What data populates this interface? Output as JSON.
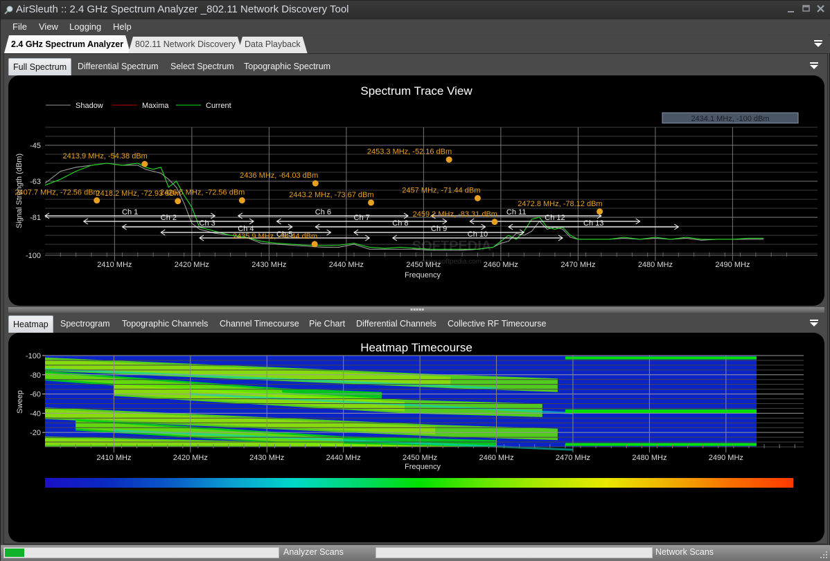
{
  "window": {
    "title": "AirSleuth :: 2.4 GHz Spectrum Analyzer _802.11 Network Discovery Tool",
    "controls": [
      "minimize",
      "maximize",
      "close"
    ]
  },
  "menu": [
    "File",
    "View",
    "Logging",
    "Help"
  ],
  "main_tabs": [
    {
      "label": "2.4 GHz Spectrum Analyzer",
      "active": true
    },
    {
      "label": "802.11 Network Discovery",
      "active": false
    },
    {
      "label": "Data Playback",
      "active": false
    }
  ],
  "spectrum_tabs": [
    {
      "label": "Full Spectrum",
      "active": true
    },
    {
      "label": "Differential Spectrum",
      "active": false
    },
    {
      "label": "Select Spectrum",
      "active": false
    },
    {
      "label": "Topographic Spectrum",
      "active": false
    }
  ],
  "analysis_tabs": [
    {
      "label": "Heatmap",
      "active": true
    },
    {
      "label": "Spectrogram",
      "active": false
    },
    {
      "label": "Topographic Channels",
      "active": false
    },
    {
      "label": "Channel Timecourse",
      "active": false
    },
    {
      "label": "Pie Chart",
      "active": false
    },
    {
      "label": "Differential Channels",
      "active": false
    },
    {
      "label": "Collective RF Timecourse",
      "active": false
    }
  ],
  "status": {
    "analyzer_label": "Analyzer Scans",
    "analyzer_progress": 0.07,
    "network_label": "Network Scans",
    "network_progress": 0.0
  },
  "watermark": "www.softpedia.com",
  "chart_data": [
    {
      "type": "line",
      "title": "Spectrum Trace View",
      "xlabel": "Frequency",
      "ylabel": "Signal Strength (dBm)",
      "xlim": [
        2401,
        2498
      ],
      "ylim": [
        -100,
        -36
      ],
      "x_ticks": [
        2410,
        2420,
        2430,
        2440,
        2450,
        2460,
        2470,
        2480,
        2490
      ],
      "x_tick_labels": [
        "2410 MHz",
        "2420 MHz",
        "2430 MHz",
        "2440 MHz",
        "2450 MHz",
        "2460 MHz",
        "2470 MHz",
        "2480 MHz",
        "2490 MHz"
      ],
      "y_ticks": [
        -45,
        -63,
        -81,
        -100
      ],
      "y_tick_labels": [
        "-45",
        "-63",
        "-81",
        "-100"
      ],
      "grid": true,
      "legend": {
        "position": "top-left",
        "entries": [
          {
            "name": "Shadow",
            "color": "#9a9a9a"
          },
          {
            "name": "Maxima",
            "color": "#c00000"
          },
          {
            "name": "Current",
            "color": "#22dd22"
          }
        ]
      },
      "cursor_readout": "2434.1 MHz,   -100 dBm",
      "series": [
        {
          "name": "Current",
          "color": "#22dd22",
          "x": [
            2401,
            2403,
            2405,
            2407,
            2409,
            2411,
            2413,
            2414,
            2415,
            2416,
            2417,
            2418,
            2419,
            2420,
            2421,
            2422,
            2423,
            2425,
            2427,
            2429,
            2431,
            2433,
            2435,
            2437,
            2439,
            2441,
            2443,
            2445,
            2447,
            2449,
            2451,
            2453,
            2455,
            2457,
            2459,
            2460,
            2461,
            2462,
            2463,
            2464,
            2465,
            2466,
            2467,
            2468,
            2469,
            2470,
            2472,
            2474,
            2476,
            2478,
            2480,
            2482,
            2484,
            2486,
            2488,
            2490,
            2492,
            2494
          ],
          "y": [
            -65,
            -62,
            -58,
            -55,
            -54,
            -55,
            -54,
            -56,
            -57,
            -56,
            -66,
            -63,
            -70,
            -76,
            -86,
            -87,
            -88,
            -90,
            -91,
            -93,
            -94,
            -94.5,
            -95,
            -95.2,
            -95,
            -94,
            -96,
            -96.5,
            -96,
            -96.5,
            -97,
            -97,
            -97,
            -97,
            -96,
            -93,
            -90,
            -92,
            -88,
            -82,
            -81,
            -86,
            -87,
            -86,
            -90,
            -92,
            -92,
            -92,
            -91,
            -92,
            -91,
            -92,
            -91,
            -92,
            -92,
            -92,
            -91.5,
            -91.5
          ]
        },
        {
          "name": "Shadow",
          "color": "#9a9a9a",
          "x": [
            2401,
            2403,
            2405,
            2407,
            2409,
            2411,
            2413,
            2414,
            2415,
            2416,
            2417,
            2418,
            2419,
            2420,
            2421,
            2422,
            2423,
            2425,
            2427,
            2429,
            2431,
            2433,
            2435,
            2437,
            2439,
            2441,
            2443,
            2445,
            2447,
            2449,
            2451,
            2453,
            2455,
            2457,
            2459,
            2460,
            2461,
            2462,
            2463,
            2464,
            2465,
            2466,
            2467,
            2468,
            2469,
            2470,
            2472,
            2474,
            2476,
            2478,
            2480,
            2482,
            2484,
            2486,
            2488,
            2490,
            2492,
            2494
          ],
          "y": [
            -64,
            -58,
            -56,
            -55,
            -54,
            -55,
            -55,
            -57,
            -58,
            -59,
            -62,
            -66,
            -74,
            -84,
            -87,
            -88,
            -89,
            -90,
            -91,
            -94,
            -94.5,
            -95,
            -95.5,
            -96,
            -96,
            -94.5,
            -97,
            -97,
            -97,
            -97,
            -97.5,
            -97.5,
            -97.5,
            -97,
            -96,
            -94,
            -93,
            -89,
            -90,
            -88,
            -83,
            -87,
            -86,
            -87,
            -91,
            -92,
            -92,
            -92,
            -91.5,
            -92,
            -91.5,
            -92,
            -91.5,
            -92.5,
            -92,
            -92,
            -92,
            -92
          ]
        }
      ],
      "peaks": [
        {
          "freq": 2407.7,
          "dbm": -72.56,
          "label": "2407.7 MHz,   -72.56 dBm"
        },
        {
          "freq": 2413.9,
          "dbm": -54.38,
          "label": "2413.9 MHz,   -54.38 dBm"
        },
        {
          "freq": 2418.2,
          "dbm": -72.93,
          "label": "2418.2 MHz,   -72.93 dBm"
        },
        {
          "freq": 2426.5,
          "dbm": -72.56,
          "label": "2426.5 MHz,   -72.56 dBm"
        },
        {
          "freq": 2435.9,
          "dbm": -94.44,
          "label": "2435.9 MHz,   -94.44 dBm"
        },
        {
          "freq": 2436,
          "dbm": -64.03,
          "label": "2436 MHz,   -64.03 dBm"
        },
        {
          "freq": 2443.2,
          "dbm": -73.67,
          "label": "2443.2 MHz,   -73.67 dBm"
        },
        {
          "freq": 2453.3,
          "dbm": -52.16,
          "label": "2453.3 MHz,   -52.16 dBm"
        },
        {
          "freq": 2457,
          "dbm": -71.44,
          "label": "2457 MHz,   -71.44 dBm"
        },
        {
          "freq": 2459.2,
          "dbm": -83.31,
          "label": "2459.2 MHz,   -83.31 dBm"
        },
        {
          "freq": 2472.8,
          "dbm": -78.12,
          "label": "2472.8 MHz,   -78.12 dBm"
        }
      ],
      "channels": [
        {
          "name": "Ch 1",
          "low": 2401,
          "high": 2423
        },
        {
          "name": "Ch 2",
          "low": 2406,
          "high": 2428
        },
        {
          "name": "Ch 3",
          "low": 2411,
          "high": 2433
        },
        {
          "name": "Ch 4",
          "low": 2416,
          "high": 2438
        },
        {
          "name": "Ch 5",
          "low": 2421,
          "high": 2443
        },
        {
          "name": "Ch 6",
          "low": 2426,
          "high": 2448
        },
        {
          "name": "Ch 7",
          "low": 2431,
          "high": 2453
        },
        {
          "name": "Ch 8",
          "low": 2436,
          "high": 2458
        },
        {
          "name": "Ch 9",
          "low": 2441,
          "high": 2463
        },
        {
          "name": "Ch 10",
          "low": 2446,
          "high": 2468
        },
        {
          "name": "Ch 11",
          "low": 2451,
          "high": 2473
        },
        {
          "name": "Ch 12",
          "low": 2456,
          "high": 2478
        },
        {
          "name": "Ch 13",
          "low": 2461,
          "high": 2483
        }
      ]
    },
    {
      "type": "heatmap",
      "title": "Heatmap Timecourse",
      "xlabel": "Frequency",
      "ylabel": "Sweep",
      "xlim": [
        2401,
        2498
      ],
      "ylim": [
        -100,
        -5
      ],
      "x_ticks": [
        2410,
        2420,
        2430,
        2440,
        2450,
        2460,
        2470,
        2480,
        2490
      ],
      "x_tick_labels": [
        "2410 MHz",
        "2420 MHz",
        "2430 MHz",
        "2440 MHz",
        "2450 MHz",
        "2460 MHz",
        "2470 MHz",
        "2480 MHz",
        "2490 MHz"
      ],
      "y_ticks": [
        -100,
        -80,
        -60,
        -40,
        -20
      ],
      "y_tick_labels": [
        "-100",
        "-80",
        "-60",
        "-40",
        "-20"
      ],
      "color_scale": [
        "#1a10c8",
        "#0a2ac0",
        "#0a5ac8",
        "#0aa0d0",
        "#00d8c8",
        "#00d870",
        "#00e000",
        "#60e800",
        "#b0e800",
        "#e8e800",
        "#f0b000",
        "#f87000",
        "#ff3800"
      ],
      "data_extent_x": [
        2401,
        2494
      ]
    }
  ]
}
